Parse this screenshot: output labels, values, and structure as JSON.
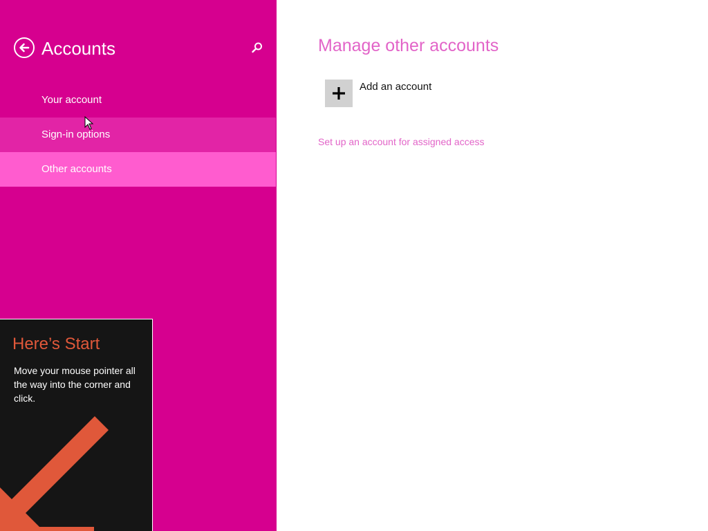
{
  "colors": {
    "accent": "#d6008f",
    "nav_hover": "#e224a6",
    "nav_selected": "#ff5ccf",
    "heading_pink": "#e264c8",
    "tip_background": "#151515",
    "tip_orange": "#e0583a"
  },
  "header": {
    "title": "Accounts",
    "back_icon": "back-arrow-circle-icon",
    "search_icon": "search-icon"
  },
  "nav": {
    "items": [
      {
        "label": "Your account",
        "state": "normal"
      },
      {
        "label": "Sign-in options",
        "state": "hover"
      },
      {
        "label": "Other accounts",
        "state": "selected"
      }
    ]
  },
  "main": {
    "title": "Manage other accounts",
    "add_account_label": "Add an account",
    "add_icon": "plus-icon",
    "assigned_access_link": "Set up an account for assigned access"
  },
  "start_tip": {
    "title": "Here’s Start",
    "body": "Move your mouse pointer all the way into the corner and click.",
    "arrow_icon": "arrow-down-left-icon"
  }
}
